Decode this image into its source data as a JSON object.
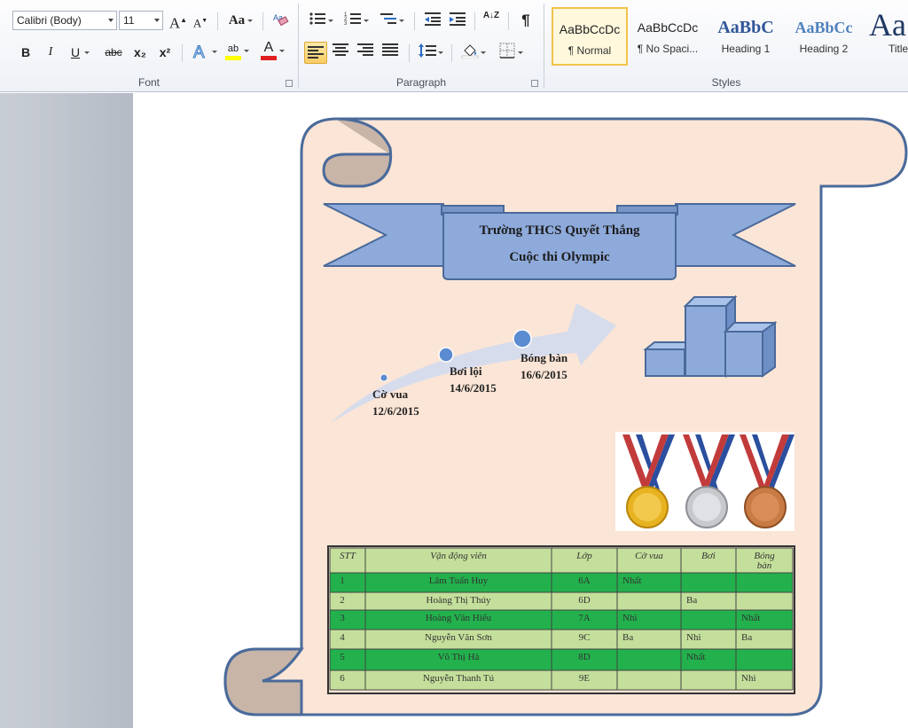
{
  "ribbon": {
    "font": {
      "font_name": "Calibri (Body)",
      "font_size": "11",
      "grow_font": "A",
      "shrink_font": "A",
      "change_case": "Aa",
      "bold": "B",
      "italic": "I",
      "underline": "U",
      "strikethrough": "abc",
      "subscript": "x₂",
      "superscript": "x²",
      "highlight": "ab",
      "font_color": "A",
      "group_label": "Font"
    },
    "paragraph": {
      "group_label": "Paragraph",
      "pilcrow": "¶",
      "sort": "A↓Z"
    },
    "styles": {
      "group_label": "Styles",
      "items": [
        {
          "sample": "AaBbCcDc",
          "name": "¶ Normal"
        },
        {
          "sample": "AaBbCcDc",
          "name": "¶ No Spaci..."
        },
        {
          "sample": "AaBbC",
          "name": "Heading 1"
        },
        {
          "sample": "AaBbCc",
          "name": "Heading 2"
        },
        {
          "sample": "Aa",
          "name": "Title"
        }
      ]
    }
  },
  "document": {
    "banner_line1": "Trường THCS Quyết Thắng",
    "banner_line2": "Cuộc thi Olympic",
    "timeline": [
      {
        "title": "Cờ vua",
        "date": "12/6/2015"
      },
      {
        "title": "Bơi lội",
        "date": "14/6/2015"
      },
      {
        "title": "Bóng bàn",
        "date": "16/6/2015"
      }
    ],
    "table": {
      "headers": [
        "STT",
        "Vận động viên",
        "Lớp",
        "Cờ vua",
        "Bơi",
        "Bóng bàn"
      ],
      "rows": [
        [
          "1",
          "Lâm Tuấn Huy",
          "6A",
          "Nhất",
          "",
          ""
        ],
        [
          "2",
          "Hoàng Thị Thúy",
          "6D",
          "",
          "Ba",
          ""
        ],
        [
          "3",
          "Hoàng Văn Hiếu",
          "7A",
          "Nhì",
          "",
          "Nhất"
        ],
        [
          "4",
          "Nguyễn Văn Sơn",
          "9C",
          "Ba",
          "Nhì",
          "Ba"
        ],
        [
          "5",
          "Võ Thị Hà",
          "8D",
          "",
          "Nhất",
          ""
        ],
        [
          "6",
          "Nguyễn Thanh Tú",
          "9E",
          "",
          "",
          "Nhì"
        ]
      ]
    }
  },
  "colors": {
    "scroll_fill": "#fbe5d6",
    "scroll_stroke": "#4a6a9a",
    "banner_fill": "#8eaadb",
    "table_dark": "#22b14c",
    "table_light": "#c4df9b",
    "accent_style": "#f2c34a"
  }
}
